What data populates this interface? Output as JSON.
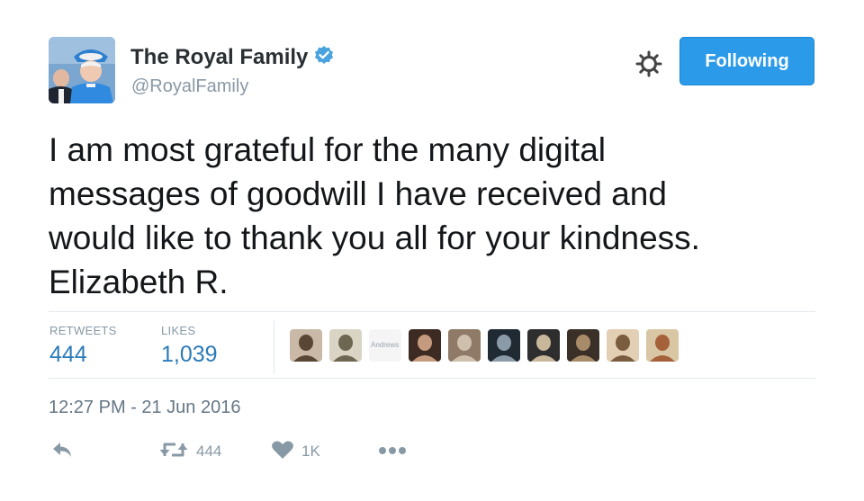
{
  "author": {
    "name": "The Royal Family",
    "handle": "@RoyalFamily",
    "verified": true,
    "avatar_icon": "profile-photo"
  },
  "follow_button": {
    "label": "Following",
    "color": "#2b9be9"
  },
  "gear_icon": "gear-icon",
  "tweet": {
    "lines": [
      "I am most grateful for the many digital",
      "messages of goodwill I have received and",
      "would like to thank you all for your kindness.",
      "Elizabeth R."
    ]
  },
  "stats": {
    "retweets_label": "RETWEETS",
    "retweets_value": "444",
    "likes_label": "LIKES",
    "likes_value": "1,039",
    "value_color": "#2b7bb9"
  },
  "likers": [
    {
      "icon": "avatar-1",
      "colors": [
        "#c9b9a6",
        "#5a4634"
      ]
    },
    {
      "icon": "avatar-2",
      "colors": [
        "#d9d4c4",
        "#6d6650"
      ]
    },
    {
      "icon": "avatar-3",
      "text": "Andrews",
      "colors": [
        "#f5f5f5",
        "#9aa4b2"
      ]
    },
    {
      "icon": "avatar-4",
      "colors": [
        "#3d2a22",
        "#c59b7f"
      ]
    },
    {
      "icon": "avatar-5",
      "colors": [
        "#8e7a66",
        "#cfc0ad"
      ]
    },
    {
      "icon": "avatar-6",
      "colors": [
        "#1f2a33",
        "#8a9aa6"
      ]
    },
    {
      "icon": "avatar-7",
      "colors": [
        "#2e2e2e",
        "#c8b79b"
      ]
    },
    {
      "icon": "avatar-8",
      "colors": [
        "#3b3028",
        "#a88c6a"
      ]
    },
    {
      "icon": "avatar-9",
      "colors": [
        "#e3cfb4",
        "#7a5c3e"
      ]
    },
    {
      "icon": "avatar-10",
      "colors": [
        "#d8c6a4",
        "#a5613a"
      ]
    }
  ],
  "timestamp": "12:27 PM - 21 Jun 2016",
  "actions": {
    "reply_icon": "reply-icon",
    "retweet_icon": "retweet-icon",
    "retweet_count": "444",
    "like_icon": "heart-icon",
    "like_count": "1K",
    "more_icon": "more-icon"
  }
}
